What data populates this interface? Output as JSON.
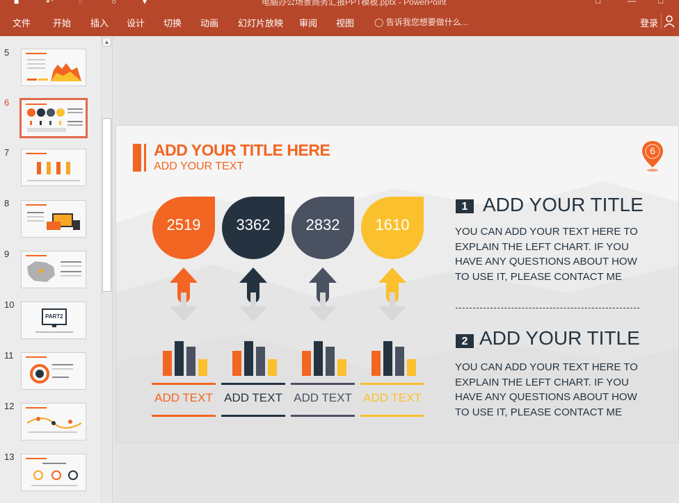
{
  "window": {
    "title": "电脑办公场景商务汇报PPT模板.pptx - PowerPoint"
  },
  "ribbon": {
    "tabs": [
      "文件",
      "开始",
      "插入",
      "设计",
      "切换",
      "动画",
      "幻灯片放映",
      "审阅",
      "视图"
    ],
    "tell_me": "告诉我您想要做什么...",
    "login": "登录"
  },
  "thumbnails": [
    {
      "number": "5",
      "active": false
    },
    {
      "number": "6",
      "active": true
    },
    {
      "number": "7",
      "active": false
    },
    {
      "number": "8",
      "active": false
    },
    {
      "number": "9",
      "active": false
    },
    {
      "number": "10",
      "active": false,
      "text": "PART2"
    },
    {
      "number": "11",
      "active": false
    },
    {
      "number": "12",
      "active": false
    },
    {
      "number": "13",
      "active": false
    }
  ],
  "slide": {
    "title": "ADD YOUR TITLE HERE",
    "subtitle": "ADD YOUR TEXT",
    "page_badge": "6",
    "items": [
      {
        "value": "2519",
        "label": "ADD TEXT",
        "color": "#f26522",
        "arrow": "#f26522"
      },
      {
        "value": "3362",
        "label": "ADD TEXT",
        "color": "#253340",
        "arrow": "#253340"
      },
      {
        "value": "2832",
        "label": "ADD TEXT",
        "color": "#4a5160",
        "arrow": "#4a5160"
      },
      {
        "value": "1610",
        "label": "ADD TEXT",
        "color": "#fbc02d",
        "arrow": "#fbc02d"
      }
    ],
    "right": [
      {
        "num": "1",
        "title": "ADD YOUR TITLE",
        "body": "YOU CAN ADD YOUR TEXT   HERE TO EXPLAIN THE LEFT CHART.  IF YOU HAVE ANY QUESTIONS ABOUT HOW TO USE IT, PLEASE CONTACT ME"
      },
      {
        "num": "2",
        "title": "ADD YOUR TITLE",
        "body": "YOU CAN ADD YOUR TEXT   HERE TO EXPLAIN THE LEFT CHART.  IF YOU HAVE ANY QUESTIONS ABOUT HOW TO USE IT, PLEASE CONTACT ME"
      }
    ]
  },
  "colors": {
    "ribbon": "#b7472a",
    "orange": "#f26522",
    "navy": "#253340",
    "slate": "#4a5160",
    "yellow": "#fbc02d"
  }
}
